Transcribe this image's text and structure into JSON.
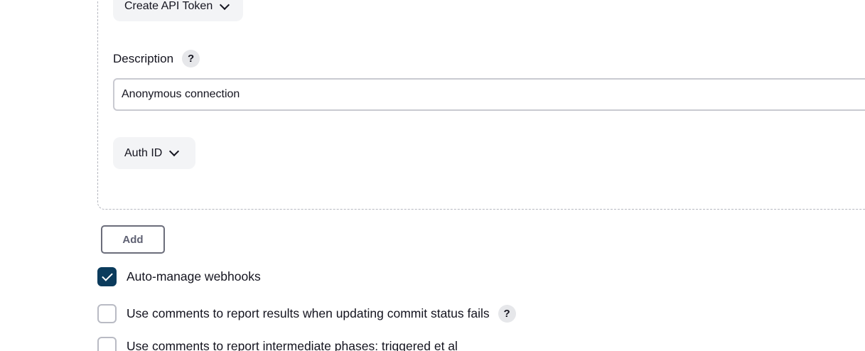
{
  "credentials": {
    "create_token_label": "Create API Token",
    "description_label": "Description",
    "description_value": "Anonymous connection",
    "auth_id_label": "Auth ID"
  },
  "add_label": "Add",
  "options": [
    {
      "label": "Auto-manage webhooks",
      "checked": true
    },
    {
      "label": "Use comments to report results when updating commit status fails",
      "checked": false
    },
    {
      "label": "Use comments to report intermediate phases: triggered et al",
      "checked": false
    }
  ],
  "help_glyph": "?",
  "colors": {
    "accent": "#0b3b5c",
    "panel_border": "#b6b8c0",
    "pill_bg": "#f3f4f6"
  }
}
